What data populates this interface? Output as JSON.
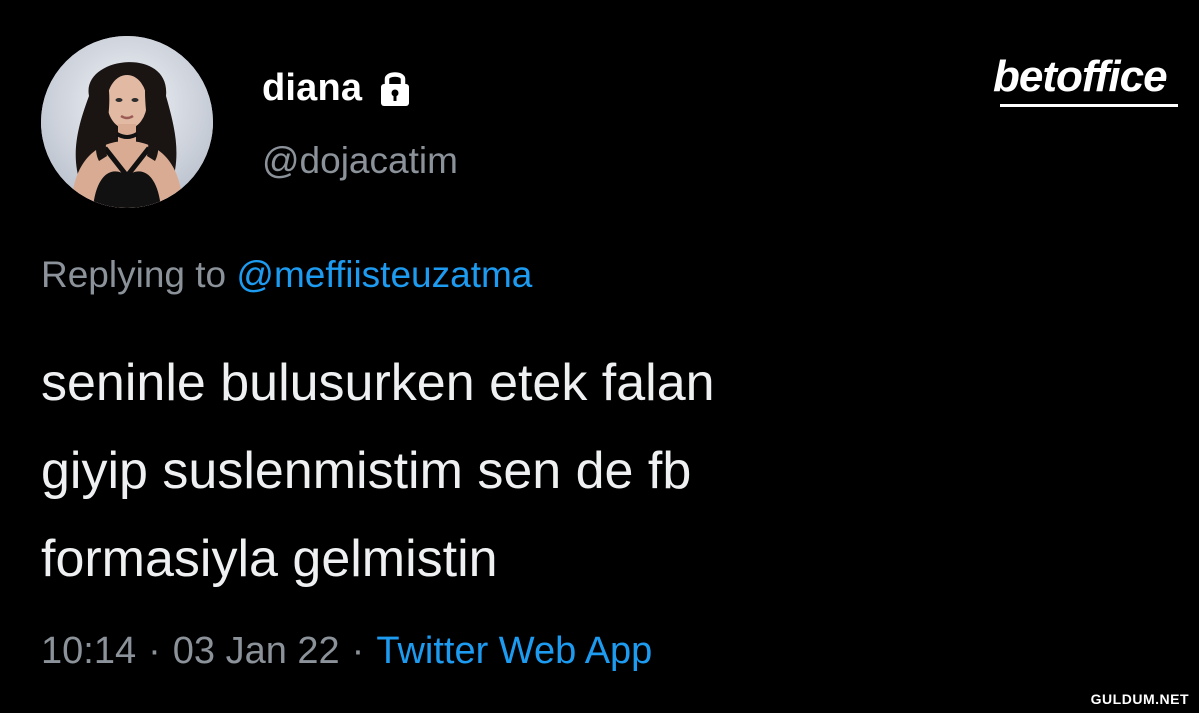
{
  "tweet": {
    "display_name": "diana",
    "handle": "@dojacatim",
    "reply_prefix": "Replying to",
    "reply_to": "@meffiisteuzatma",
    "text_lines": [
      "seninle bulusurken etek falan",
      "giyip suslenmistim sen de fb",
      "formasiyla gelmistin"
    ],
    "time": "10:14",
    "date": "03 Jan 22",
    "separator": "·",
    "source_app": "Twitter Web App"
  },
  "icons": {
    "lock": "lock-icon",
    "avatar": "avatar-image"
  },
  "watermarks": {
    "brand_logo": "betoffice",
    "site": "GULDUM.NET"
  },
  "colors": {
    "background": "#000000",
    "primary_text": "#e7e9ea",
    "secondary_text": "#8b9299",
    "link_blue": "#1d9bf0"
  }
}
